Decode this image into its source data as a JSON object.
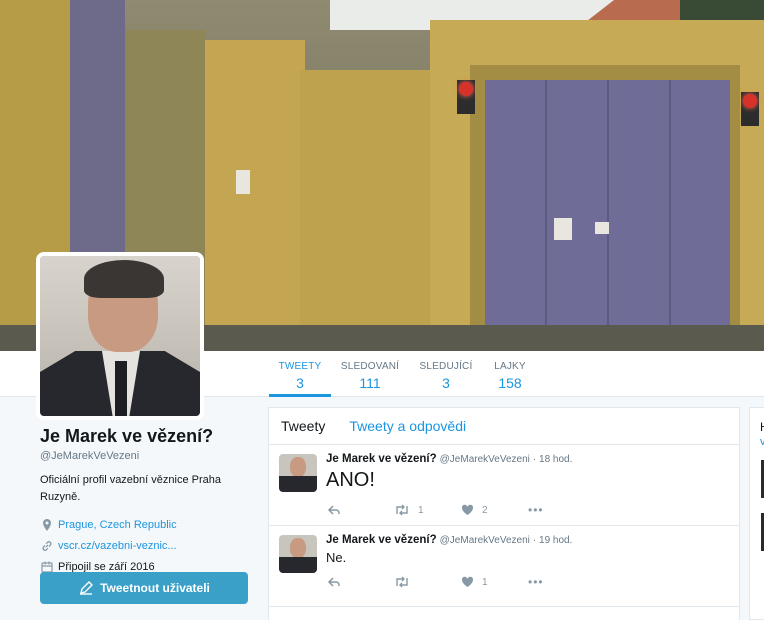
{
  "nav": {
    "items": [
      {
        "label": "TWEETY",
        "count": "3"
      },
      {
        "label": "SLEDOVANÍ",
        "count": "111"
      },
      {
        "label": "SLEDUJÍCÍ",
        "count": "3"
      },
      {
        "label": "LAJKY",
        "count": "158"
      }
    ]
  },
  "profile": {
    "name": "Je Marek ve vězení?",
    "handle": "@JeMarekVeVezeni",
    "bio": "Oficiální profil vazební věznice Praha Ruzyně.",
    "location": "Prague, Czech Republic",
    "website": "vscr.cz/vazebni-veznic...",
    "joined": "Připojil se září 2016",
    "tweet_button": "Tweetnout uživateli"
  },
  "timeline": {
    "tabs": [
      "Tweety",
      "Tweety a odpovědi"
    ],
    "tweets": [
      {
        "name": "Je Marek ve vězení?",
        "handle": "@JeMarekVeVezeni",
        "time": "· 18 hod.",
        "text": "ANO!",
        "retweets": "1",
        "likes": "2"
      },
      {
        "name": "Je Marek ve vězení?",
        "handle": "@JeMarekVeVezeni",
        "time": "· 19 hod.",
        "text": "Ne.",
        "retweets": "",
        "likes": "1"
      }
    ]
  },
  "sidecard": {
    "k": "H",
    "v": "v"
  },
  "colors": {
    "accent": "#1b95e0",
    "button": "#3aa0c8"
  }
}
